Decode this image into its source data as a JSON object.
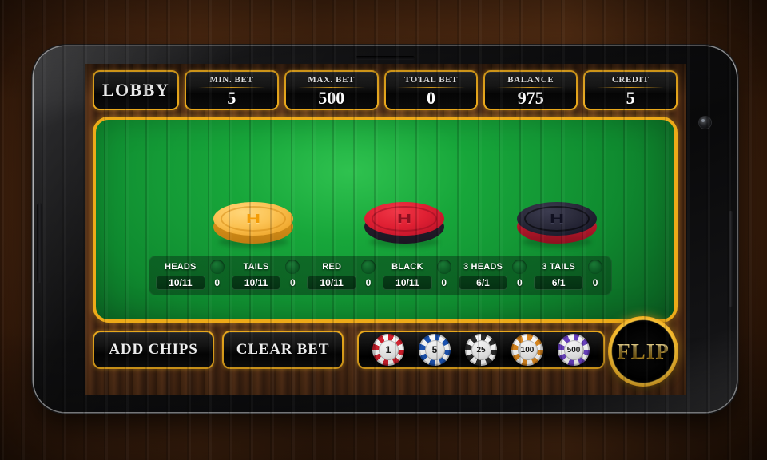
{
  "topbar": {
    "lobby_label": "LOBBY",
    "stats": [
      {
        "label": "MIN. BET",
        "value": "5"
      },
      {
        "label": "MAX. BET",
        "value": "500"
      },
      {
        "label": "TOTAL BET",
        "value": "0"
      },
      {
        "label": "BALANCE",
        "value": "975"
      },
      {
        "label": "CREDIT",
        "value": "5"
      }
    ]
  },
  "table": {
    "coins": [
      {
        "name": "heads-coin",
        "letter": "H",
        "color": "#f0a92f"
      },
      {
        "name": "red-coin",
        "letter": "H",
        "color": "#e02033"
      },
      {
        "name": "black-coin",
        "letter": "H",
        "color": "#19192a"
      }
    ],
    "bets": [
      {
        "name": "HEADS",
        "odds": "10/11",
        "stake": "0"
      },
      {
        "name": "TAILS",
        "odds": "10/11",
        "stake": "0"
      },
      {
        "name": "RED",
        "odds": "10/11",
        "stake": "0"
      },
      {
        "name": "BLACK",
        "odds": "10/11",
        "stake": "0"
      },
      {
        "name": "3 HEADS",
        "odds": "6/1",
        "stake": "0"
      },
      {
        "name": "3 TAILS",
        "odds": "6/1",
        "stake": "0"
      }
    ]
  },
  "controls": {
    "add_chips_label": "ADD CHIPS",
    "clear_bet_label": "CLEAR BET",
    "flip_label": "FLIP",
    "chips": [
      {
        "value": "1",
        "color": "#d81f2d"
      },
      {
        "value": "5",
        "color": "#1d56b8"
      },
      {
        "value": "25",
        "color": "#2b2b2b"
      },
      {
        "value": "100",
        "color": "#e08a1e"
      },
      {
        "value": "500",
        "color": "#6a3fc4"
      }
    ]
  },
  "theme": {
    "gold": "#e9a81c",
    "felt_green": "#149a36",
    "panel_black": "#050505"
  }
}
